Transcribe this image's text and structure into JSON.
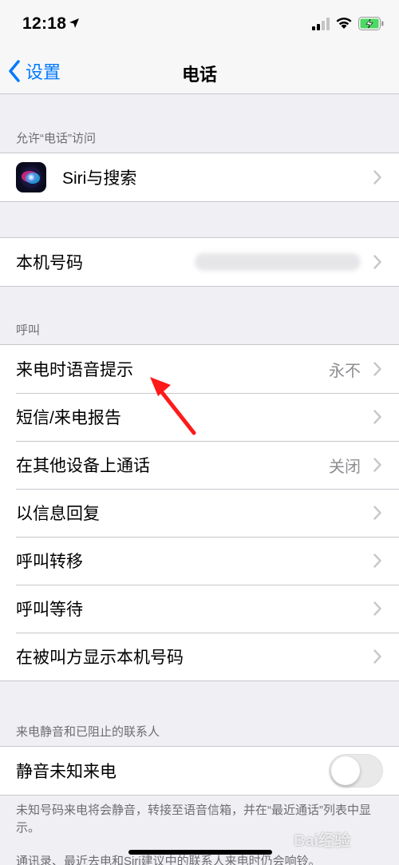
{
  "status_bar": {
    "time": "12:18"
  },
  "nav": {
    "back_label": "设置",
    "title": "电话"
  },
  "sections": {
    "allow_access": {
      "header": "允许“电话”访问",
      "siri_label": "Siri与搜索"
    },
    "my_number": {
      "label": "本机号码"
    },
    "calls": {
      "header": "呼叫",
      "items": [
        {
          "label": "来电时语音提示",
          "value": "永不"
        },
        {
          "label": "短信/来电报告"
        },
        {
          "label": "在其他设备上通话",
          "value": "关闭"
        },
        {
          "label": "以信息回复"
        },
        {
          "label": "呼叫转移"
        },
        {
          "label": "呼叫等待"
        },
        {
          "label": "在被叫方显示本机号码"
        }
      ]
    },
    "silence": {
      "header": "来电静音和已阻止的联系人",
      "toggle_label": "静音未知来电",
      "toggle_on": false,
      "note": "未知号码来电将会静音，转接至语音信箱，并在“最近通话”列表中显示。",
      "note2": "通讯录、最近去电和Siri建议中的联系人来电时仍会响铃。"
    }
  },
  "watermark": "Bai经验",
  "colors": {
    "accent": "#007aff",
    "annotation": "#ff1a1a"
  }
}
